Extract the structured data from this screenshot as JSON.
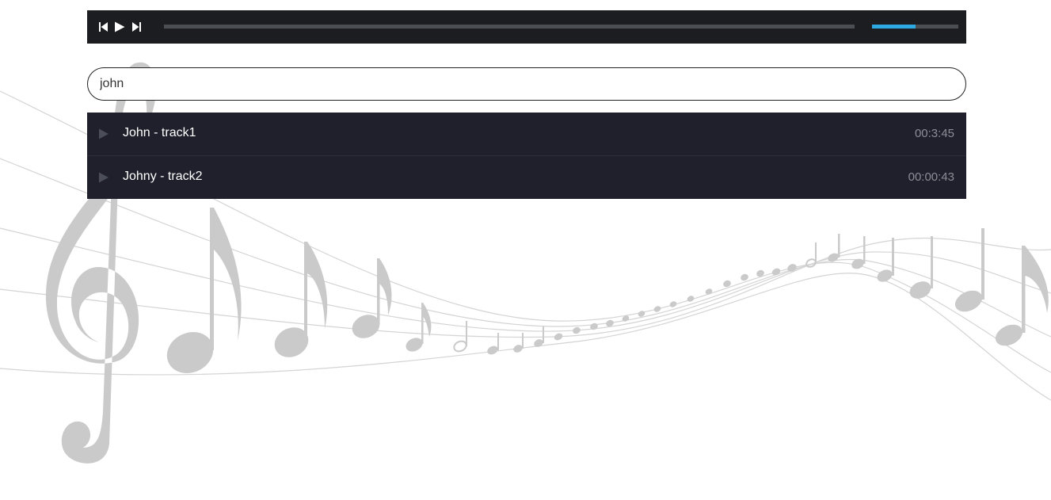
{
  "player": {
    "prev_icon": "skip-previous-icon",
    "play_icon": "play-icon",
    "next_icon": "skip-next-icon",
    "progress": 0,
    "volume": 0.5,
    "accent_color": "#2ea8e0",
    "bar_background": "#1b1d21"
  },
  "search": {
    "value": "john",
    "placeholder": ""
  },
  "tracks": [
    {
      "title": "John - track1",
      "duration": "00:3:45"
    },
    {
      "title": "Johny - track2",
      "duration": "00:00:43"
    }
  ],
  "colors": {
    "list_background": "#1f202b",
    "track_title": "#ffffff",
    "track_duration": "#8c8e96",
    "background_art": "#cccccc"
  },
  "background": {
    "illustration": "music-staff-with-treble-clef-and-notes"
  }
}
